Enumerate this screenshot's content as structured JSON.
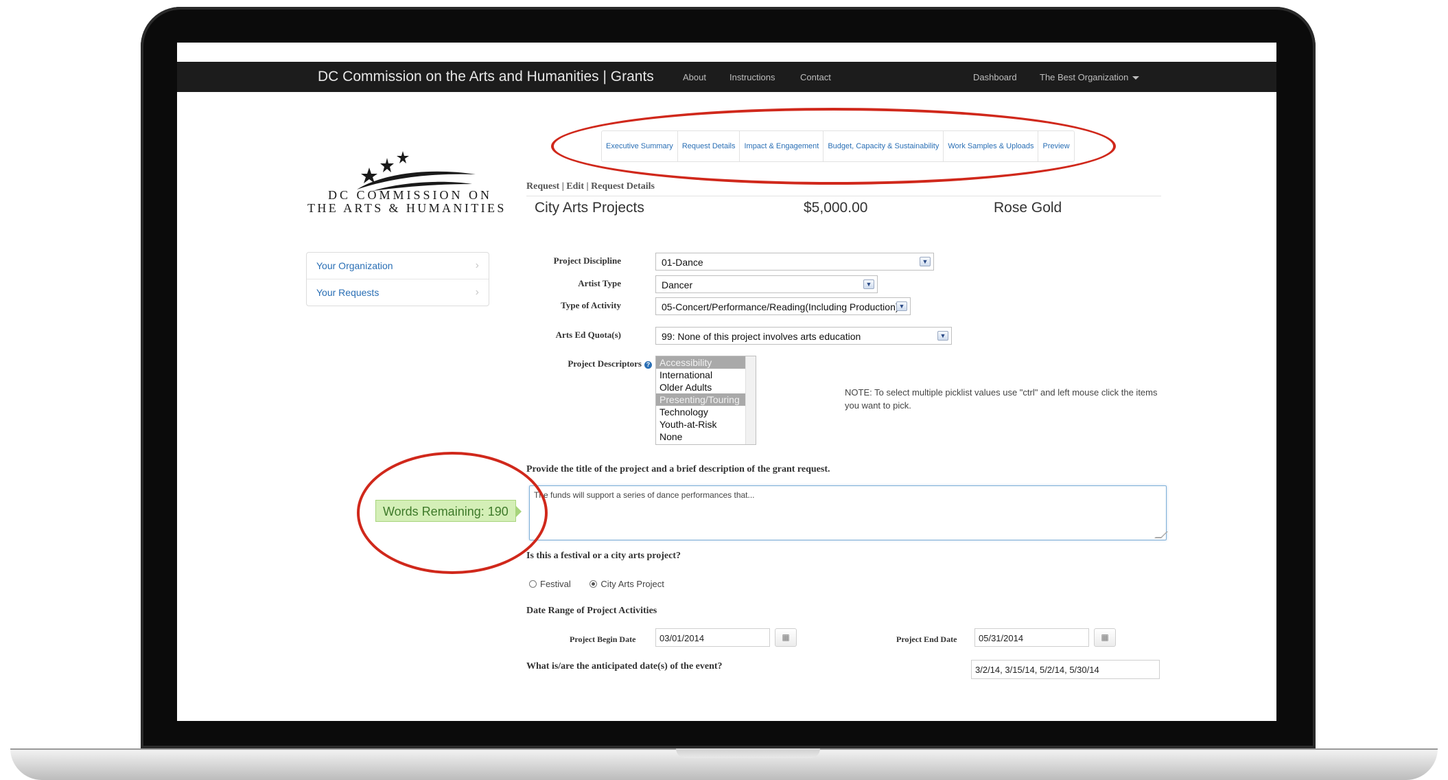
{
  "navbar": {
    "brand": "DC Commission on the Arts and Humanities | Grants",
    "links": [
      "About",
      "Instructions",
      "Contact"
    ],
    "dashboard": "Dashboard",
    "org_menu": "The Best Organization"
  },
  "logo": {
    "line1": "DC COMMISSION ON",
    "line2": "THE ARTS & HUMANITIES"
  },
  "tabs": [
    "Executive Summary",
    "Request Details",
    "Impact & Engagement",
    "Budget, Capacity & Sustainability",
    "Work Samples & Uploads",
    "Preview"
  ],
  "breadcrumb": "Request | Edit | Request Details",
  "header": {
    "program": "City Arts Projects",
    "amount": "$5,000.00",
    "contact": "Rose Gold"
  },
  "sidebar": {
    "items": [
      {
        "label": "Your Organization"
      },
      {
        "label": "Your Requests"
      }
    ]
  },
  "form": {
    "project_discipline": {
      "label": "Project Discipline",
      "value": "01-Dance"
    },
    "artist_type": {
      "label": "Artist Type",
      "value": "Dancer"
    },
    "type_of_activity": {
      "label": "Type of Activity",
      "value": "05-Concert/Performance/Reading(Including Production)"
    },
    "arts_ed_quota": {
      "label": "Arts Ed Quota(s)",
      "value": "99: None of this project involves arts education"
    },
    "project_descriptors": {
      "label": "Project Descriptors",
      "options": [
        {
          "label": "Accessibility",
          "selected": true
        },
        {
          "label": "International",
          "selected": false
        },
        {
          "label": "Older Adults",
          "selected": false
        },
        {
          "label": "Presenting/Touring",
          "selected": true
        },
        {
          "label": "Technology",
          "selected": false
        },
        {
          "label": "Youth-at-Risk",
          "selected": false
        },
        {
          "label": "None",
          "selected": false
        }
      ]
    },
    "note": "NOTE: To select multiple picklist values use \"ctrl\" and left mouse click the items you want to pick.",
    "description_question": "Provide the title of the project and a brief description of the grant request.",
    "description_value": "The funds will support a series of dance performances that...",
    "words_remaining": "Words Remaining: 190",
    "festival_question": "Is this a festival or a city arts project?",
    "radio_festival": "Festival",
    "radio_city_arts": "City Arts Project",
    "radio_selected": "City Arts Project",
    "date_range_heading": "Date Range of Project Activities",
    "begin_date_label": "Project Begin Date",
    "begin_date_value": "03/01/2014",
    "end_date_label": "Project End Date",
    "end_date_value": "05/31/2014",
    "event_dates_question": "What is/are the anticipated date(s) of the event?",
    "event_dates_value": "3/2/14, 3/15/14, 5/2/14, 5/30/14"
  },
  "colors": {
    "annotation_circle": "#d0281b",
    "link_blue": "#2a6fb5",
    "navbar_bg": "#1c1c1c",
    "words_badge_bg": "#d4efb7"
  },
  "icons": {
    "calendar": "calendar-icon",
    "help": "help-icon",
    "dropdown": "chevron-down-icon",
    "sidebar_chevron": "chevron-right-icon"
  }
}
